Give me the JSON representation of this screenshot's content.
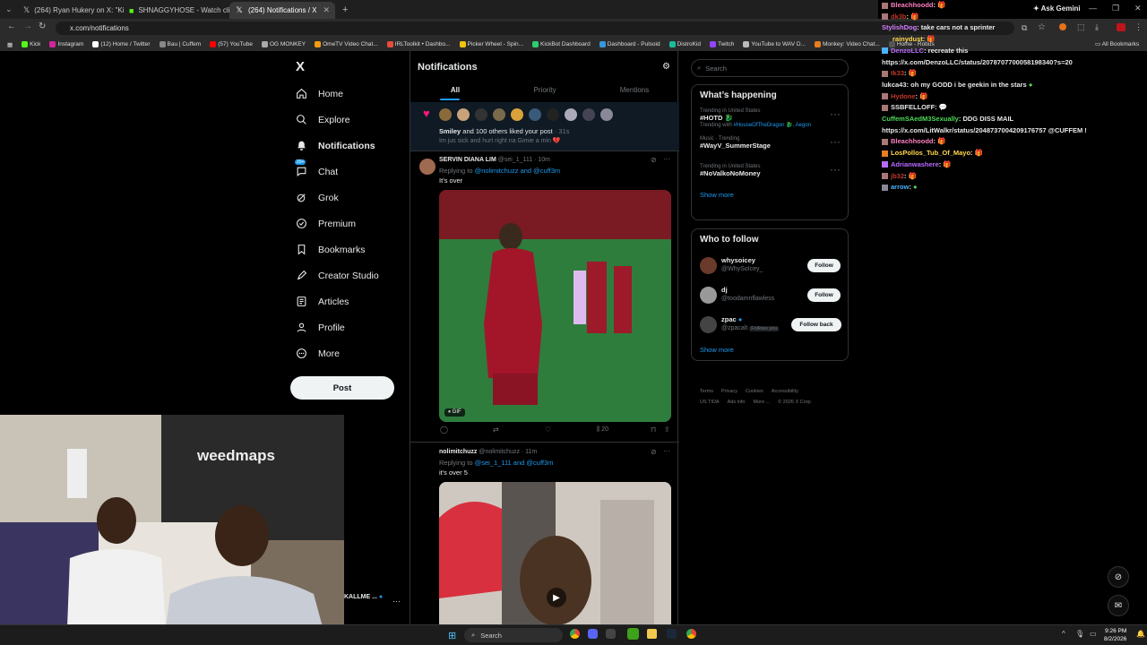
{
  "browser": {
    "tabs": [
      {
        "title": "(264) Ryan Hukery on X: \"Kick \"",
        "active": false
      },
      {
        "title": "SHNAGGYHOSE - Watch clips o",
        "active": false
      },
      {
        "title": "(264) Notifications / X",
        "active": true
      }
    ],
    "url": "x.com/notifications",
    "ask_gemini": "Ask Gemini",
    "bookmarks": [
      "Kick",
      "Instagram",
      "(12) Home / Twitter",
      "Bau | Cuffem",
      "(57) YouTube",
      "OG MONKEY",
      "OmeTV Video Chat...",
      "IRLToolkit • Dashbo...",
      "Picker Wheel - Spin...",
      "KickBot Dashboard",
      "Dashboard - Pulsoid",
      "DistroKid",
      "Twitch",
      "YouTube to WAV D...",
      "Monkey: Video Chat...",
      "Home - Robus"
    ],
    "all_bookmarks": "All Bookmarks"
  },
  "nav": {
    "logo": "X",
    "items": [
      {
        "label": "Home",
        "icon": "home-icon"
      },
      {
        "label": "Explore",
        "icon": "search-icon"
      },
      {
        "label": "Notifications",
        "icon": "bell-icon",
        "bold": true
      },
      {
        "label": "Chat",
        "icon": "chat-icon",
        "badge": "20+"
      },
      {
        "label": "Grok",
        "icon": "grok-icon"
      },
      {
        "label": "Premium",
        "icon": "premium-icon"
      },
      {
        "label": "Bookmarks",
        "icon": "bookmark-icon"
      },
      {
        "label": "Creator Studio",
        "icon": "rocket-icon"
      },
      {
        "label": "Articles",
        "icon": "article-icon"
      },
      {
        "label": "Profile",
        "icon": "person-icon"
      },
      {
        "label": "More",
        "icon": "more-icon"
      }
    ],
    "post_label": "Post",
    "account_name": "KALLME ..."
  },
  "main": {
    "title": "Notifications",
    "tabs": [
      "All",
      "Priority",
      "Mentions"
    ],
    "like_notice": {
      "who": "Smiley",
      "text": " and 100 others liked your post",
      "time": " · 31s",
      "quote": "Im jus sick and hurt right na Gimie a min 💔"
    },
    "tweets": [
      {
        "name": "SERVIN DIANA LIM",
        "handle": "@sei_1_111 · 10m",
        "replying_prefix": "Replying to ",
        "replying_to": "@nolimitchuzz and @cuff3m",
        "text": "It’s over",
        "media_tag": "GIF",
        "views": "20"
      },
      {
        "name": "nolimitchuzz",
        "handle": "@nolimitchuzz · 11m",
        "replying_prefix": "Replying to ",
        "replying_to": "@sei_1_111 and @cuff3m",
        "text": "it's over 5"
      }
    ]
  },
  "right": {
    "search_placeholder": "Search",
    "happening_title": "What’s happening",
    "trends": [
      {
        "context": "Trending in United States",
        "title": "#HOTD 🐉",
        "extra": "Trending with ",
        "extra_link": "#HouseOfTheDragon 🐉, Aegon"
      },
      {
        "context": "Music · Trending",
        "title": "#WayV_SummerStage",
        "extra": "",
        "extra_link": ""
      },
      {
        "context": "Trending in United States",
        "title": "#NoValkoNoMoney",
        "extra": "",
        "extra_link": ""
      }
    ],
    "show_more": "Show more",
    "follow_title": "Who to follow",
    "follows": [
      {
        "name": "whysoicey",
        "handle": "@WhySoIcey_",
        "button": "Follow",
        "follows_you": ""
      },
      {
        "name": "dj",
        "handle": "@toodamnflawless",
        "button": "Follow",
        "follows_you": ""
      },
      {
        "name": "zpac",
        "handle": "@zpacalt",
        "button": "Follow back",
        "follows_you": "Follows you"
      }
    ],
    "footer_row1": [
      "Terms",
      "Privacy",
      "Cookies",
      "Accessibility"
    ],
    "footer_row2": [
      "US TIDA",
      "Ads info",
      "More ...",
      "© 2026 X Corp."
    ]
  },
  "chat": [
    {
      "user": "Bleachhoodd",
      "color": "#ff7fbf",
      "msg": ":"
    },
    {
      "user": "dk3b",
      "color": "#c0392b",
      "msg": ":"
    },
    {
      "user": "StylishDog",
      "color": "#d57cff",
      "msg": ":  take cars not a sprinter"
    },
    {
      "user": "rainydust",
      "color": "#ffd84d",
      "msg": ":"
    },
    {
      "user": "DenzoLLC",
      "color": "#b86bff",
      "msg": ":  recreate this"
    },
    {
      "user": "",
      "color": "#e7e9ea",
      "msg": "https://x.com/DenzoLLC/status/2078707700058198340?s=20"
    },
    {
      "user": "tk33",
      "color": "#c0392b",
      "msg": ":"
    },
    {
      "user": "lukca43",
      "color": "#e7e9ea",
      "msg": ":  oh my GODD i be geekin in the stars"
    },
    {
      "user": "Hydone",
      "color": "#c0392b",
      "msg": ":"
    },
    {
      "user": "SSBFELLOFF",
      "color": "#e7e9ea",
      "msg": ":"
    },
    {
      "user": "CuffemSAedM3Sexually",
      "color": "#4ddb57",
      "msg": ":  DDG DISS MAIL"
    },
    {
      "user": "",
      "color": "#e7e9ea",
      "msg": "https://x.com/LitWalkr/status/2048737004209176757 @CUFFEM !"
    },
    {
      "user": "Bleachhoodd",
      "color": "#ff7fbf",
      "msg": ":"
    },
    {
      "user": "LosPollos_Tub_Of_Mayo",
      "color": "#ffd84d",
      "msg": ":"
    },
    {
      "user": "Adrianwashere",
      "color": "#b86bff",
      "msg": ":"
    },
    {
      "user": "jb32",
      "color": "#c0392b",
      "msg": ":"
    },
    {
      "user": "arrow",
      "color": "#4ab3ff",
      "msg": ":"
    }
  ],
  "taskbar": {
    "search": "Search",
    "time": "9:26 PM",
    "date": "8/2/2026"
  },
  "camera": {
    "sign_text": "weedmaps"
  }
}
